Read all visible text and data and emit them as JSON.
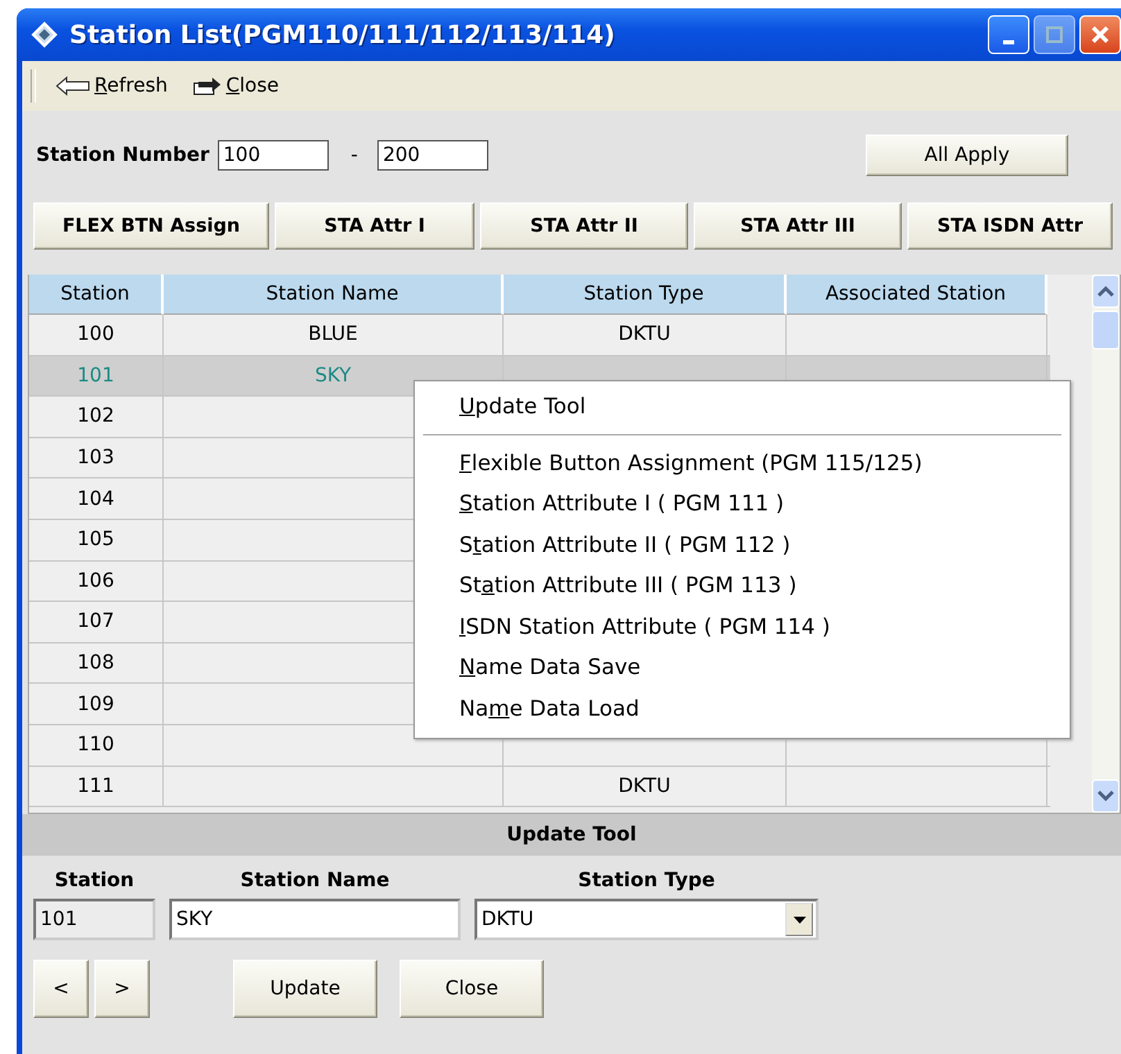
{
  "window": {
    "title": "Station List(PGM110/111/112/113/114)"
  },
  "toolbar": [
    {
      "kind": "refresh",
      "key": "R",
      "post": "efresh"
    },
    {
      "kind": "close",
      "key": "C",
      "post": "lose"
    }
  ],
  "range": {
    "label": "Station Number",
    "from": "100",
    "separator": "-",
    "to": "200",
    "apply": "All Apply"
  },
  "program_buttons": [
    "FLEX BTN Assign",
    "STA Attr I",
    "STA Attr II",
    "STA Attr III",
    "STA ISDN Attr"
  ],
  "table": {
    "columns": [
      "Station",
      "Station Name",
      "Station Type",
      "Associated Station"
    ],
    "rows": [
      {
        "station": "100",
        "name": "BLUE",
        "type": "DKTU",
        "selected": false
      },
      {
        "station": "101",
        "name": "SKY",
        "selected": true
      },
      {
        "station": "102",
        "selected": false
      },
      {
        "station": "103",
        "selected": false
      },
      {
        "station": "104",
        "selected": false
      },
      {
        "station": "105",
        "selected": false
      },
      {
        "station": "106",
        "selected": false
      },
      {
        "station": "107",
        "selected": false
      },
      {
        "station": "108",
        "selected": false
      },
      {
        "station": "109",
        "selected": false
      },
      {
        "station": "110",
        "selected": false
      },
      {
        "station": "111",
        "type": "DKTU",
        "selected": false
      }
    ]
  },
  "context_menu": [
    {
      "kind": "item",
      "key": "U",
      "post": "pdate Tool"
    },
    {
      "kind": "separator"
    },
    {
      "kind": "item",
      "key": "F",
      "post": "lexible Button Assignment (PGM 115/125)"
    },
    {
      "kind": "item",
      "key": "S",
      "post": "tation Attribute I ( PGM 111 )"
    },
    {
      "kind": "item",
      "pre": "S",
      "key": "t",
      "post": "ation Attribute II ( PGM 112 )"
    },
    {
      "kind": "item",
      "pre": "St",
      "key": "a",
      "post": "tion Attribute III ( PGM 113 )"
    },
    {
      "kind": "item",
      "key": "I",
      "post": "SDN Station Attribute ( PGM 114 )"
    },
    {
      "kind": "item",
      "key": "N",
      "post": "ame Data Save"
    },
    {
      "kind": "item",
      "pre": "Na",
      "key": "m",
      "post": "e Data Load"
    }
  ],
  "update_tool": {
    "title": "Update Tool",
    "station_label": "Station",
    "station": "101",
    "name_label": "Station Name",
    "name": "SKY",
    "type_label": "Station Type",
    "type": "DKTU",
    "prev": "<",
    "next": ">",
    "update": "Update",
    "close": "Close"
  }
}
